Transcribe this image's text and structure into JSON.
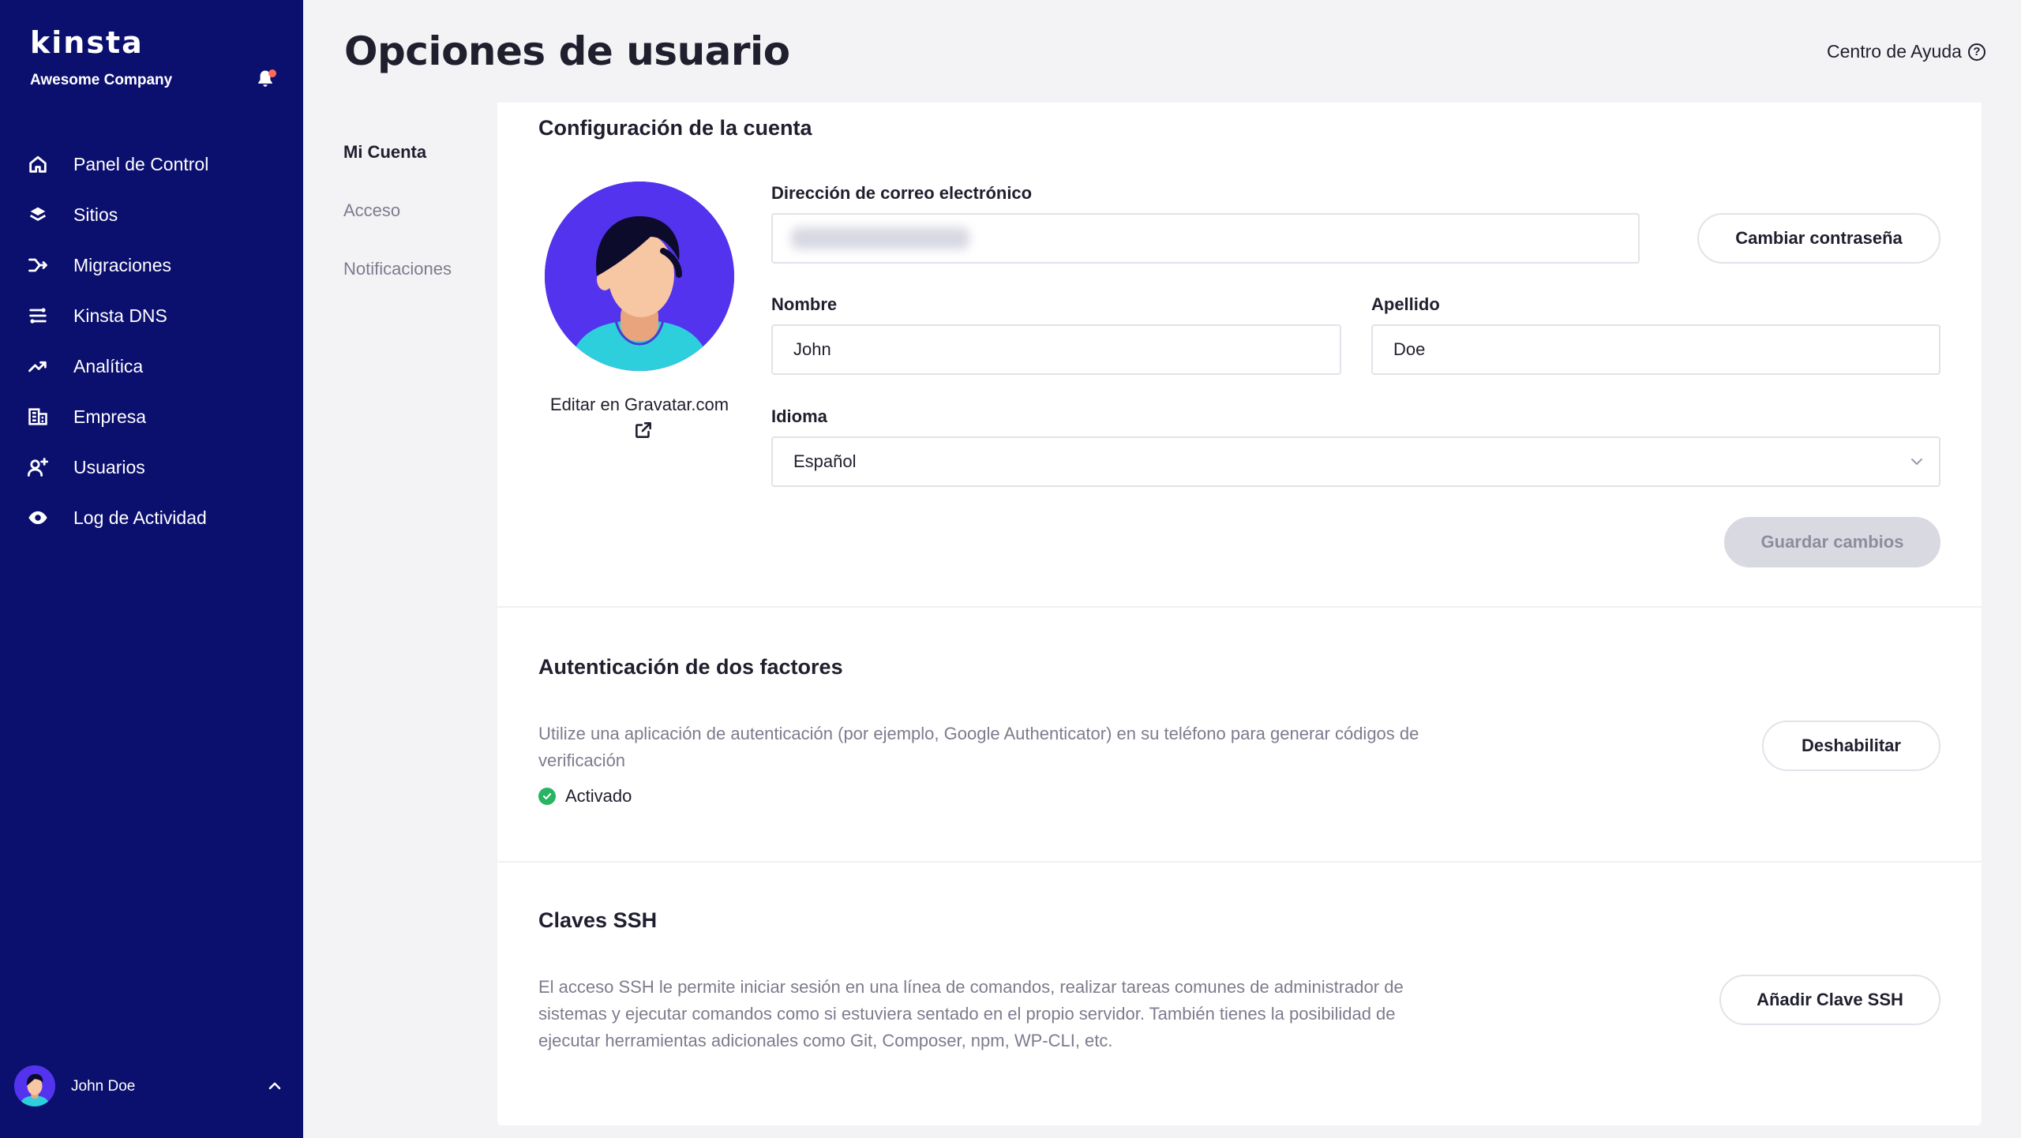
{
  "sidebar": {
    "brand": "kinsta",
    "company": "Awesome Company",
    "nav": [
      {
        "label": "Panel de Control",
        "icon": "home-icon"
      },
      {
        "label": "Sitios",
        "icon": "layers-icon"
      },
      {
        "label": "Migraciones",
        "icon": "migration-icon"
      },
      {
        "label": "Kinsta DNS",
        "icon": "dns-icon"
      },
      {
        "label": "Analítica",
        "icon": "trend-icon"
      },
      {
        "label": "Empresa",
        "icon": "building-icon"
      },
      {
        "label": "Usuarios",
        "icon": "add-user-icon"
      },
      {
        "label": "Log de Actividad",
        "icon": "eye-icon"
      }
    ],
    "user_name": "John Doe"
  },
  "header": {
    "title": "Opciones de usuario",
    "help": "Centro de Ayuda"
  },
  "subnav": [
    {
      "label": "Mi Cuenta",
      "active": true
    },
    {
      "label": "Acceso",
      "active": false
    },
    {
      "label": "Notificaciones",
      "active": false
    }
  ],
  "account": {
    "title": "Configuración de la cuenta",
    "gravatar_link": "Editar en Gravatar.com",
    "email_label": "Dirección de correo electrónico",
    "change_password": "Cambiar contraseña",
    "first_name_label": "Nombre",
    "first_name": "John",
    "last_name_label": "Apellido",
    "last_name": "Doe",
    "language_label": "Idioma",
    "language": "Español",
    "save": "Guardar cambios"
  },
  "two_factor": {
    "title": "Autenticación de dos factores",
    "description": "Utilize una aplicación de autenticación (por ejemplo, Google Authenticator) en su teléfono para generar códigos de verificación",
    "status": "Activado",
    "disable": "Deshabilitar"
  },
  "ssh": {
    "title": "Claves SSH",
    "description": "El acceso SSH le permite iniciar sesión en una línea de comandos, realizar tareas comunes de administrador de sistemas y ejecutar comandos como si estuviera sentado en el propio servidor. También tienes la posibilidad de ejecutar herramientas adicionales como Git, Composer, npm, WP-CLI, etc.",
    "add": "Añadir Clave SSH"
  },
  "colors": {
    "sidebar": "#0b0f6e",
    "accent": "#5333ed",
    "success": "#28b463"
  }
}
